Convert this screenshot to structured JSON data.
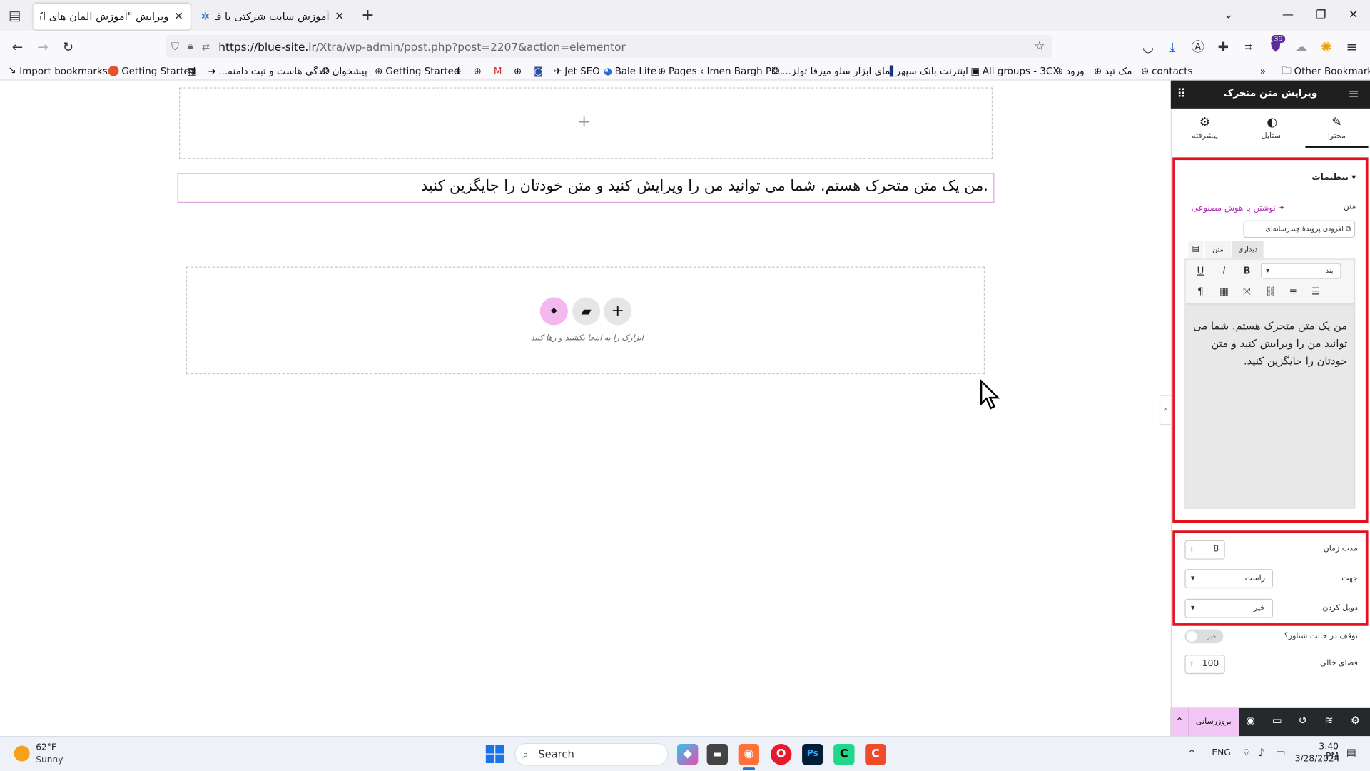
{
  "browser": {
    "tabs": [
      {
        "title": "ویرایش \"آموزش المان های اکسترا – ما"
      },
      {
        "title": "آموزش سایت شرکتی با قالب اکس"
      }
    ],
    "url": {
      "host": "https://blue-site.ir",
      "path": "/Xtra/wp-admin/post.php?post=2207&action=elementor"
    },
    "extension_badge": "39",
    "bookmarks": [
      "Import bookmarks...",
      "Getting Started",
      "...ندگی هاست و ثبت دامنه",
      "پیشخوان",
      "Getting Started",
      "Jet SEO",
      "Bale Lite",
      "Pages ‹ Imen Bargh Pi...",
      "...نمای ابزار سلو میزفا تولز",
      "اینترنت بانک سپهر",
      "All groups - 3CX",
      "ورود",
      "مک تید",
      "contacts"
    ],
    "other_bookmarks": "Other Bookmarks"
  },
  "canvas": {
    "add_icon": "+",
    "moving_text": ".من یک متن متحرک هستم. شما می توانید من را ویرایش کنید و متن خودتان را جایگزین کنید",
    "drop_hint": "ابزارک را به اینجا بکشید و رها کنید"
  },
  "panel": {
    "title": "ویرایش متن متحرک",
    "tabs": [
      {
        "label": "محتوا",
        "icon": "pencil-icon"
      },
      {
        "label": "استایل",
        "icon": "contrast-icon"
      },
      {
        "label": "پیشرفته",
        "icon": "gear-icon"
      }
    ],
    "section_title": "تنظیمات",
    "text_label": "متن",
    "ai_link": "نوشتن با هوش مصنوعی",
    "add_media": "افزودن پروندهٔ چندرسانه‌ای",
    "editor_tabs": {
      "visual": "دیداری",
      "text": "متن"
    },
    "format_select": "بند",
    "editor_content": "من یک متن متحرک هستم. شما می توانید من را ویرایش کنید و متن خودتان را جایگزین کنید.",
    "fields": {
      "duration": {
        "label": "مدت زمان",
        "value": "8"
      },
      "direction": {
        "label": "جهت",
        "value": "راست"
      },
      "loop": {
        "label": "دوبل کردن",
        "value": "خیر"
      },
      "pause": {
        "label": "توقف در حالت شناور؟",
        "value": "خیر"
      },
      "space": {
        "label": "فضای خالی",
        "value": "100"
      }
    },
    "update_button": "بروزرسانی"
  },
  "taskbar": {
    "weather_temp": "62°F",
    "weather_desc": "Sunny",
    "search_placeholder": "Search",
    "lang": "ENG",
    "time": "3:40 PM",
    "date": "3/28/2024"
  },
  "colors": {
    "highlight_red": "#e3101f",
    "elementor_pink": "#d5a2e2",
    "panel_dark": "#1f1f1f"
  }
}
